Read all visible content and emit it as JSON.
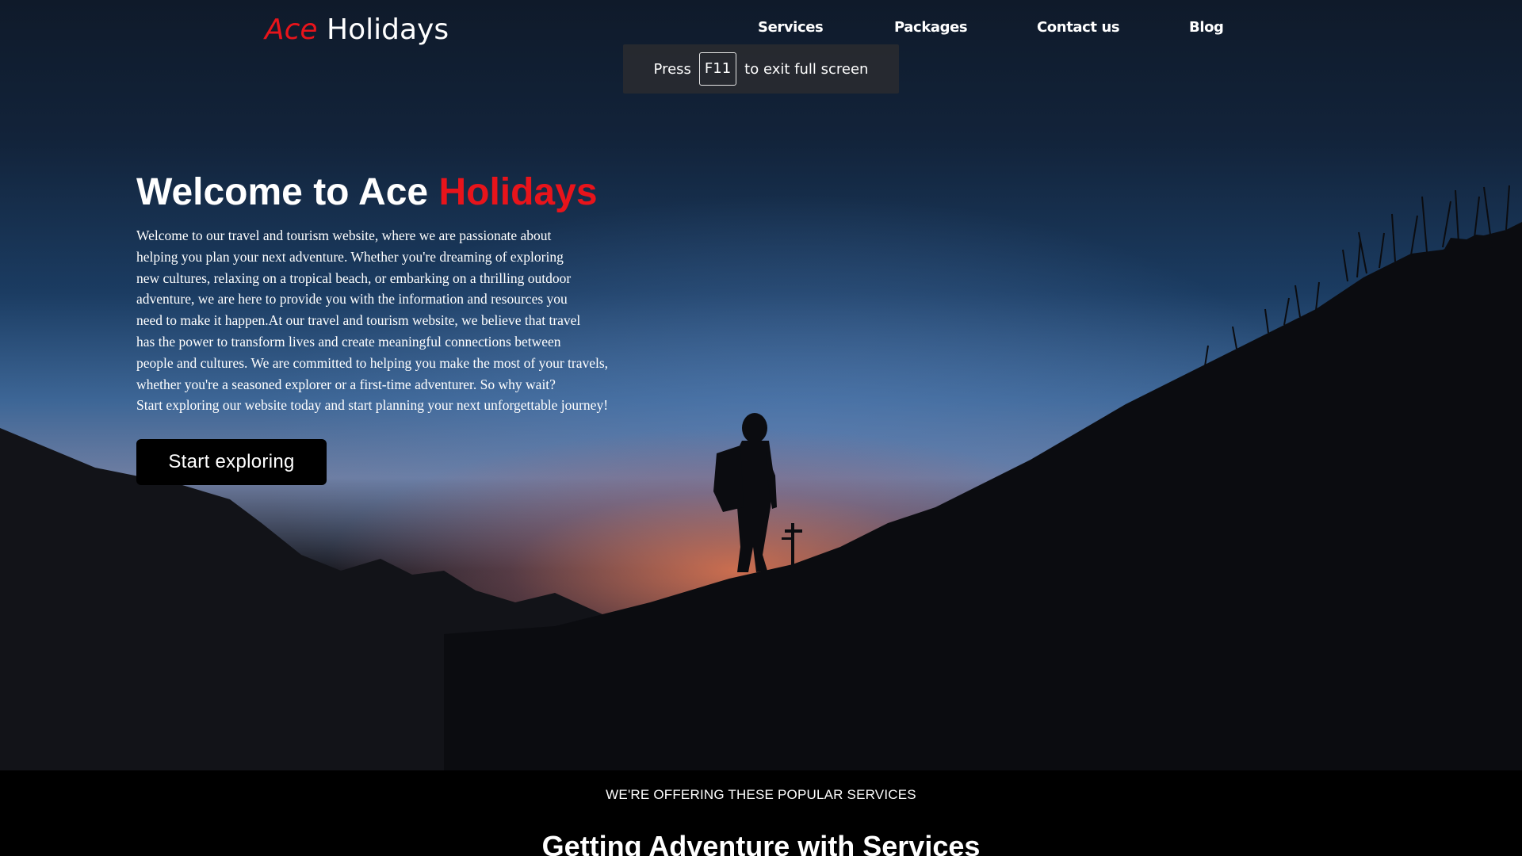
{
  "nav": {
    "logo_accent": "Ace",
    "logo_rest": "Holidays",
    "links": [
      {
        "label": "Services"
      },
      {
        "label": "Packages"
      },
      {
        "label": "Contact us"
      },
      {
        "label": "Blog"
      }
    ]
  },
  "fullscreen_notice": {
    "before": "Press",
    "key": "F11",
    "after": "to exit full screen"
  },
  "hero": {
    "title_plain": "Welcome to Ace ",
    "title_accent": "Holidays",
    "paragraph_lines": [
      "Welcome to our travel and tourism website, where we are passionate about",
      "helping you plan your next adventure. Whether you're dreaming of exploring",
      "new cultures, relaxing on a tropical beach, or embarking on a thrilling outdoor",
      "adventure, we are here to provide you with the information and resources you",
      "need to make it happen.At our travel and tourism website, we believe that travel",
      "has the power to transform lives and create meaningful connections between",
      "people and cultures. We are committed to helping you make the most of your travels,",
      "whether you're a seasoned explorer or a first-time adventurer. So why wait?",
      "Start exploring our website today and start planning your next unforgettable journey!"
    ],
    "cta_label": "Start exploring"
  },
  "services": {
    "eyebrow": "WE'RE OFFERING THESE POPULAR SERVICES",
    "heading": "Getting Adventure with Services"
  },
  "colors": {
    "accent": "#e8141b",
    "nav_text": "#ffffff",
    "section_bg": "#000000"
  }
}
